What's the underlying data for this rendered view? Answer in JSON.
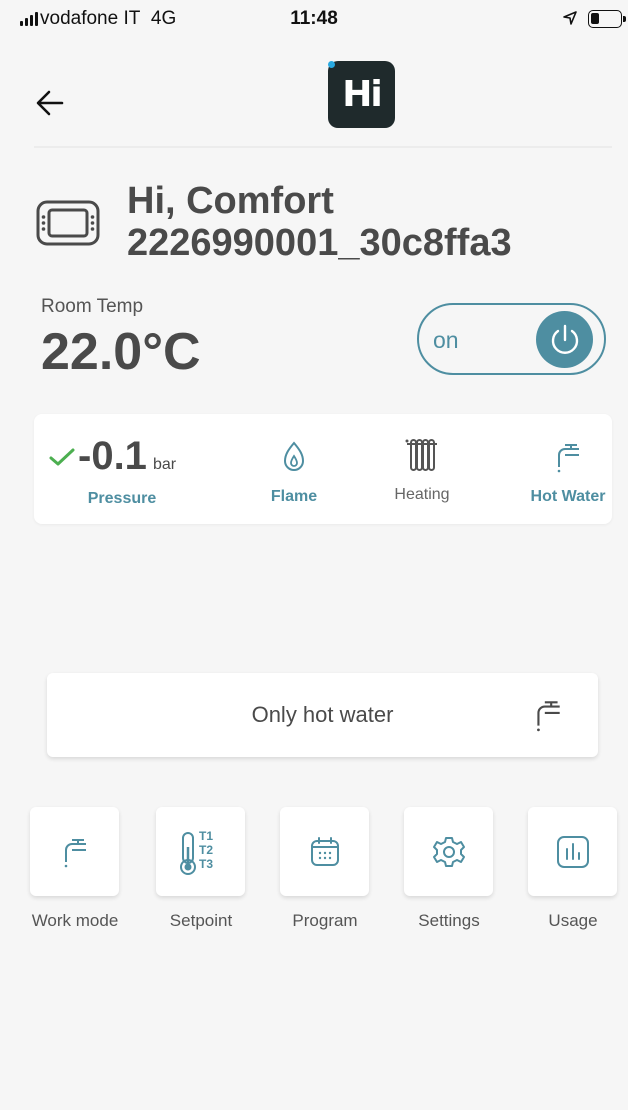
{
  "status_bar": {
    "carrier": "vodafone IT",
    "network": "4G",
    "time": "11:48"
  },
  "header": {
    "logo_text": "Hi"
  },
  "device": {
    "line1": "Hi, Comfort",
    "line2": "2226990001_30c8ffa3"
  },
  "room": {
    "label": "Room Temp",
    "value": "22.0°C"
  },
  "power": {
    "label": "on"
  },
  "status": {
    "pressure_value": "-0.1",
    "pressure_unit": "bar",
    "pressure_label": "Pressure",
    "flame_label": "Flame",
    "heating_label": "Heating",
    "hot_water_label": "Hot Water"
  },
  "mode": {
    "label": "Only hot water"
  },
  "actions": [
    {
      "label": "Work mode"
    },
    {
      "label": "Setpoint"
    },
    {
      "label": "Program"
    },
    {
      "label": "Settings"
    },
    {
      "label": "Usage"
    }
  ],
  "setpoint_tags": [
    "T1",
    "T2",
    "T3"
  ],
  "colors": {
    "accent": "#4e8ea1",
    "check": "#4caf50",
    "text": "#4a4a4a",
    "background": "#f6f6f6"
  }
}
